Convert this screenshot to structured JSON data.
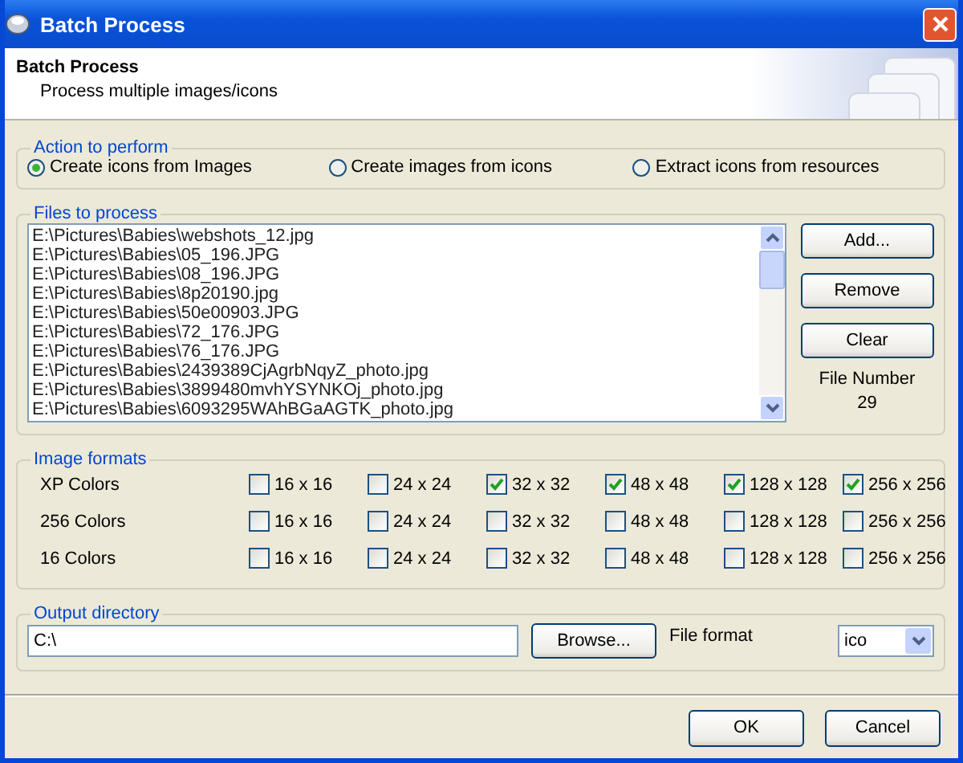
{
  "window": {
    "title": "Batch Process"
  },
  "header": {
    "title": "Batch Process",
    "subtitle": "Process multiple images/icons"
  },
  "action_group": {
    "legend": "Action to perform",
    "options": [
      {
        "label": "Create icons from Images",
        "selected": true
      },
      {
        "label": "Create images from icons",
        "selected": false
      },
      {
        "label": "Extract icons from resources",
        "selected": false
      }
    ]
  },
  "files_group": {
    "legend": "Files to process",
    "files": [
      "E:\\Pictures\\Babies\\webshots_12.jpg",
      "E:\\Pictures\\Babies\\05_196.JPG",
      "E:\\Pictures\\Babies\\08_196.JPG",
      "E:\\Pictures\\Babies\\8p20190.jpg",
      "E:\\Pictures\\Babies\\50e00903.JPG",
      "E:\\Pictures\\Babies\\72_176.JPG",
      "E:\\Pictures\\Babies\\76_176.JPG",
      "E:\\Pictures\\Babies\\2439389CjAgrbNqyZ_photo.jpg",
      "E:\\Pictures\\Babies\\3899480mvhYSYNKOj_photo.jpg",
      "E:\\Pictures\\Babies\\6093295WAhBGaAGTK_photo.jpg"
    ],
    "buttons": [
      "Add...",
      "Remove",
      "Clear"
    ],
    "count_label": "File Number",
    "count": "29"
  },
  "formats_group": {
    "legend": "Image formats",
    "rows": [
      {
        "label": "XP Colors",
        "options": [
          {
            "label": "16 x 16",
            "checked": false
          },
          {
            "label": "24 x 24",
            "checked": false
          },
          {
            "label": "32 x 32",
            "checked": true
          },
          {
            "label": "48 x 48",
            "checked": true
          },
          {
            "label": "128 x 128",
            "checked": true
          },
          {
            "label": "256 x 256",
            "checked": true
          }
        ]
      },
      {
        "label": "256 Colors",
        "options": [
          {
            "label": "16 x 16",
            "checked": false
          },
          {
            "label": "24 x 24",
            "checked": false
          },
          {
            "label": "32 x 32",
            "checked": false
          },
          {
            "label": "48 x 48",
            "checked": false
          },
          {
            "label": "128 x 128",
            "checked": false
          },
          {
            "label": "256 x 256",
            "checked": false
          }
        ]
      },
      {
        "label": "16 Colors",
        "options": [
          {
            "label": "16 x 16",
            "checked": false
          },
          {
            "label": "24 x 24",
            "checked": false
          },
          {
            "label": "32 x 32",
            "checked": false
          },
          {
            "label": "48 x 48",
            "checked": false
          },
          {
            "label": "128 x 128",
            "checked": false
          },
          {
            "label": "256 x 256",
            "checked": false
          }
        ]
      }
    ]
  },
  "output_group": {
    "legend": "Output directory",
    "directory": "C:\\",
    "browse": "Browse...",
    "format_label": "File format",
    "format": "ico"
  },
  "buttons": [
    "OK",
    "Cancel"
  ]
}
